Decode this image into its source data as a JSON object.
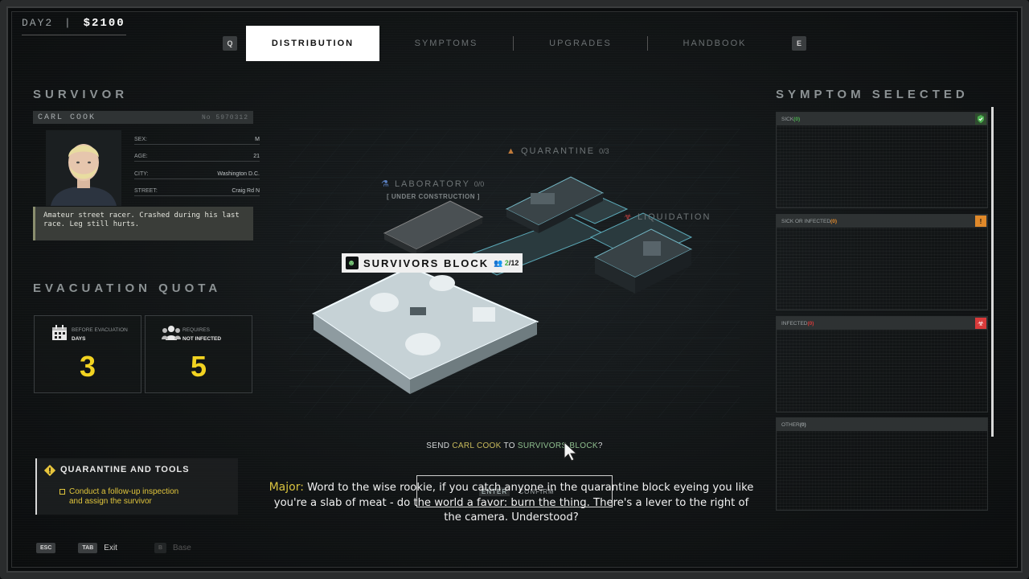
{
  "hud": {
    "day": "DAY2",
    "separator": "|",
    "money": "$2100"
  },
  "tabs": {
    "prev_key": "Q",
    "next_key": "E",
    "items": [
      {
        "label": "DISTRIBUTION",
        "active": true
      },
      {
        "label": "SYMPTOMS",
        "active": false
      },
      {
        "label": "UPGRADES",
        "active": false
      },
      {
        "label": "HANDBOOK",
        "active": false
      }
    ]
  },
  "survivor": {
    "section_title": "SURVIVOR",
    "name": "CARL COOK",
    "number": "No 5970312",
    "fields": [
      {
        "key": "SEX:",
        "value": "M"
      },
      {
        "key": "AGE:",
        "value": "21"
      },
      {
        "key": "CITY:",
        "value": "Washington D.C."
      },
      {
        "key": "STREET:",
        "value": "Craig Rd N"
      }
    ],
    "bio": "Amateur street racer. Crashed during his last race. Leg still hurts."
  },
  "quota": {
    "section_title": "EVACUATION QUOTA",
    "days": {
      "label_top": "BEFORE EVACUATION",
      "label_bottom": "DAYS",
      "value": "3",
      "icon": "calendar-icon"
    },
    "required": {
      "label_top": "REQUIRES",
      "label_bottom": "NOT INFECTED",
      "value": "5",
      "icon": "people-icon"
    }
  },
  "quest": {
    "title": "QUARANTINE AND TOOLS",
    "task_line1": "Conduct a follow-up inspection",
    "task_line2": "and assign the survivor"
  },
  "map": {
    "quarantine": {
      "label": "QUARANTINE",
      "occupancy": "0/3"
    },
    "laboratory": {
      "label": "LABORATORY",
      "occupancy": "0/0",
      "status": "[ UNDER CONSTRUCTION ]"
    },
    "liquidation": {
      "label": "LIQUIDATION"
    },
    "survivors": {
      "label": "SURVIVORS BLOCK",
      "occupied": "2",
      "capacity": "/12"
    }
  },
  "prompt": {
    "send": "SEND",
    "name": "CARL COOK",
    "to": "TO",
    "destination": "SURVIVORS BLOCK",
    "q": "?"
  },
  "dialog": {
    "speaker": "Major:",
    "line": "Word to the wise rookie, if you catch anyone in the quarantine block eyeing you like you're a slab of meat - do the world a favor: burn the thing. There's a lever to the right of the camera. Understood?",
    "confirm_key": "ENTER",
    "confirm_label": "CONFIRM"
  },
  "symptoms": {
    "section_title": "SYMPTOM SELECTED",
    "categories": [
      {
        "label": "SICK",
        "count": "(0)",
        "color": "#4caf50",
        "icon": "shield-check-icon"
      },
      {
        "label": "SICK OR INFECTED",
        "count": "(0)",
        "color": "#e0892a",
        "icon": "warning-icon"
      },
      {
        "label": "INFECTED",
        "count": "(0)",
        "color": "#d83a3a",
        "icon": "biohazard-icon"
      },
      {
        "label": "OTHER",
        "count": "(0)",
        "color": "#9aa0a2",
        "icon": ""
      }
    ]
  },
  "footer": {
    "esc_key": "ESC",
    "tab_key": "TAB",
    "exit_label": "Exit",
    "b_key": "B",
    "base_label": "Base"
  }
}
